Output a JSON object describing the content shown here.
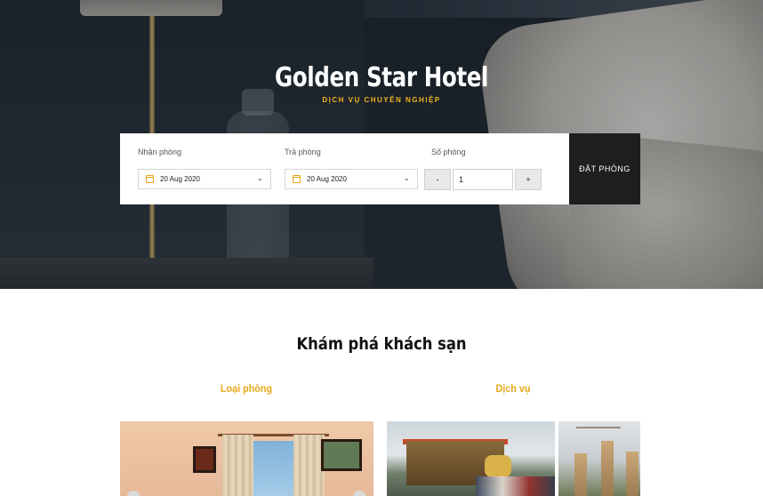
{
  "hero": {
    "title": "Golden Star Hotel",
    "subtitle": "DỊCH VỤ CHUYÊN NGHIỆP"
  },
  "booking": {
    "checkin": {
      "label": "Nhận phòng",
      "value": "20 Aug 2020"
    },
    "checkout": {
      "label": "Trả phòng",
      "value": "20 Aug 2020"
    },
    "rooms": {
      "label": "Số phòng",
      "minus": "-",
      "value": "1",
      "plus": "+"
    },
    "submit": "ĐẶT PHÒNG"
  },
  "explore": {
    "title": "Khám phá khách sạn",
    "categories": [
      {
        "label": "Loại phòng"
      },
      {
        "label": "Dịch vụ"
      }
    ]
  },
  "colors": {
    "accent": "#e8a81a",
    "dark_button": "#1e1e1e"
  },
  "icons": {
    "calendar": "calendar-icon",
    "chevron": "chevron-down-icon"
  }
}
